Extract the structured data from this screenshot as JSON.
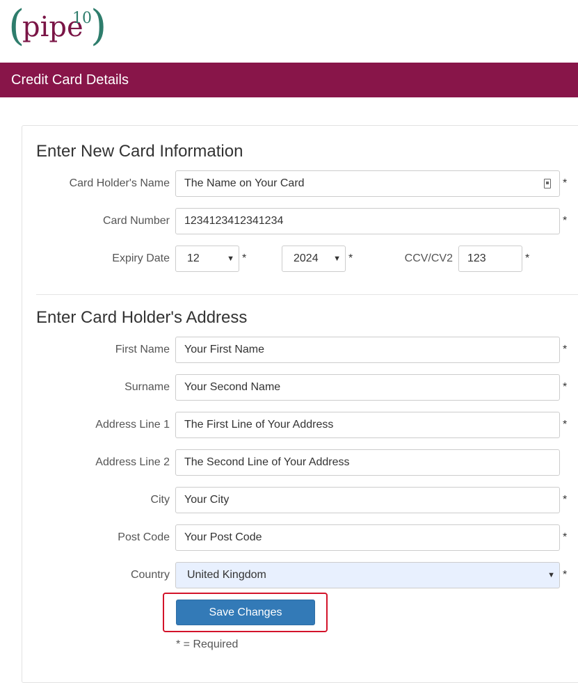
{
  "logo": {
    "word": "pipe",
    "superscript": "10",
    "left_paren": "(",
    "right_paren": ")"
  },
  "header": {
    "title": "Credit Card Details"
  },
  "card_section": {
    "title": "Enter New Card Information",
    "holder_name": {
      "label": "Card Holder's Name",
      "value": "The Name on Your Card"
    },
    "card_number": {
      "label": "Card Number",
      "value": "1234123412341234"
    },
    "expiry": {
      "label": "Expiry Date",
      "month": "12",
      "year": "2024"
    },
    "ccv": {
      "label": "CCV/CV2",
      "value": "123"
    }
  },
  "address_section": {
    "title": "Enter Card Holder's Address",
    "first_name": {
      "label": "First Name",
      "value": "Your First Name"
    },
    "surname": {
      "label": "Surname",
      "value": "Your Second Name"
    },
    "address1": {
      "label": "Address Line 1",
      "value": "The First Line of Your Address"
    },
    "address2": {
      "label": "Address Line 2",
      "value": "The Second Line of Your Address"
    },
    "city": {
      "label": "City",
      "value": "Your City"
    },
    "post_code": {
      "label": "Post Code",
      "value": "Your Post Code"
    },
    "country": {
      "label": "Country",
      "value": "United Kingdom"
    }
  },
  "required_mark": "*",
  "caret": "▼",
  "actions": {
    "save_label": "Save Changes"
  },
  "required_note": "* = Required",
  "colors": {
    "brand": "#881549",
    "accent_teal": "#2e7d6c",
    "button": "#337ab7",
    "highlight": "#d3132a",
    "autofill": "#e8f0fe"
  },
  "icons": {
    "holder_field": "contact-card-icon"
  }
}
